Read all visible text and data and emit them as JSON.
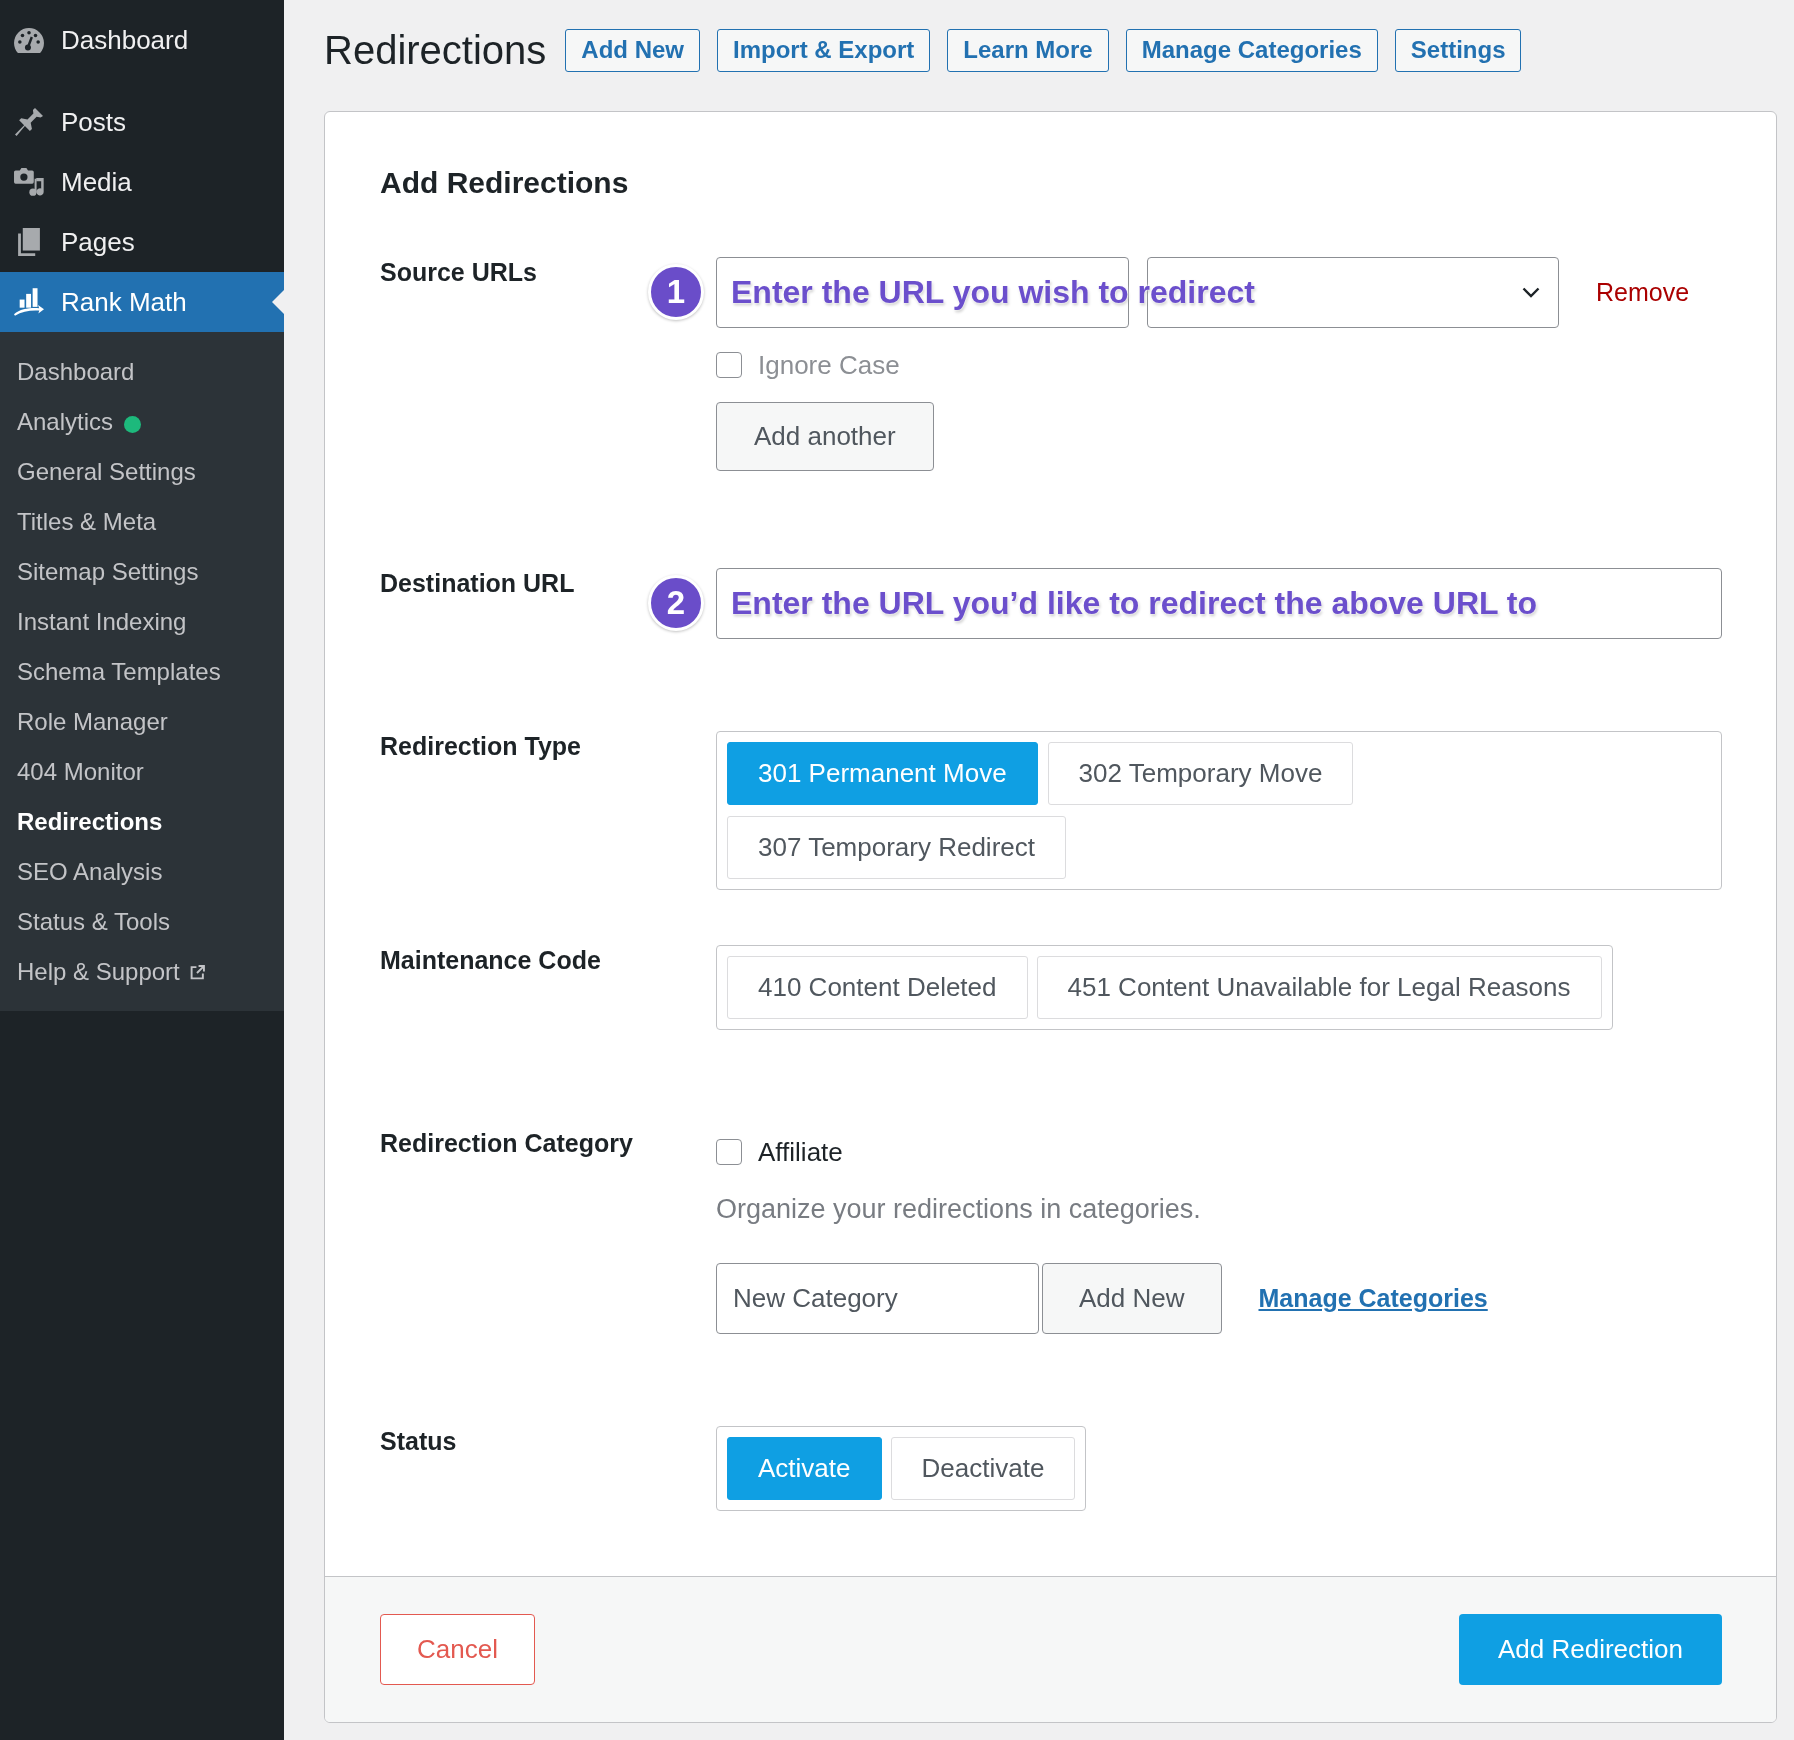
{
  "sidebar": {
    "menu": [
      {
        "label": "Dashboard",
        "selected": false
      },
      {
        "label": "Posts",
        "selected": false
      },
      {
        "label": "Media",
        "selected": false
      },
      {
        "label": "Pages",
        "selected": false
      },
      {
        "label": "Rank Math",
        "selected": true
      }
    ],
    "submenu": [
      {
        "label": "Dashboard",
        "selected": false,
        "external": false
      },
      {
        "label": "Analytics",
        "selected": false,
        "external": false,
        "color": "#1db97c"
      },
      {
        "label": "General Settings",
        "selected": false,
        "external": false
      },
      {
        "label": "Titles & Meta",
        "selected": false,
        "external": false
      },
      {
        "label": "Sitemap Settings",
        "selected": false,
        "external": false
      },
      {
        "label": "Instant Indexing",
        "selected": false,
        "external": false
      },
      {
        "label": "Schema Templates",
        "selected": false,
        "external": false
      },
      {
        "label": "Role Manager",
        "selected": false,
        "external": false
      },
      {
        "label": "404 Monitor",
        "selected": false,
        "external": false
      },
      {
        "label": "Redirections",
        "selected": true,
        "external": false
      },
      {
        "label": "SEO Analysis",
        "selected": false,
        "external": false
      },
      {
        "label": "Status & Tools",
        "selected": false,
        "external": false
      },
      {
        "label": "Help & Support",
        "selected": false,
        "external": true
      }
    ]
  },
  "header": {
    "title": "Redirections",
    "buttons": [
      "Add New",
      "Import & Export",
      "Learn More",
      "Manage Categories",
      "Settings"
    ]
  },
  "form": {
    "heading": "Add Redirections",
    "source": {
      "label": "Source URLs",
      "step": "1",
      "annotation": "Enter the URL you wish to redirect",
      "remove": "Remove",
      "ignore_case": {
        "label": "Ignore Case",
        "checked": false
      },
      "add_another": "Add another"
    },
    "destination": {
      "label": "Destination URL",
      "step": "2",
      "annotation": "Enter the URL you’d like to redirect the above URL to"
    },
    "redirection_type": {
      "label": "Redirection Type",
      "options": [
        {
          "label": "301 Permanent Move",
          "selected": true
        },
        {
          "label": "302 Temporary Move",
          "selected": false
        },
        {
          "label": "307 Temporary Redirect",
          "selected": false
        }
      ]
    },
    "maintenance_code": {
      "label": "Maintenance Code",
      "options": [
        {
          "label": "410 Content Deleted",
          "selected": false
        },
        {
          "label": "451 Content Unavailable for Legal Reasons",
          "selected": false
        }
      ]
    },
    "category": {
      "label": "Redirection Category",
      "checkboxes": [
        {
          "label": "Affiliate",
          "checked": false
        }
      ],
      "help": "Organize your redirections in categories.",
      "new_category": {
        "placeholder": "New Category"
      },
      "add_button": "Add New",
      "manage_link": "Manage Categories"
    },
    "status": {
      "label": "Status",
      "options": [
        {
          "label": "Activate",
          "selected": true
        },
        {
          "label": "Deactivate",
          "selected": false
        }
      ]
    }
  },
  "footer": {
    "cancel": "Cancel",
    "submit": "Add Redirection"
  }
}
